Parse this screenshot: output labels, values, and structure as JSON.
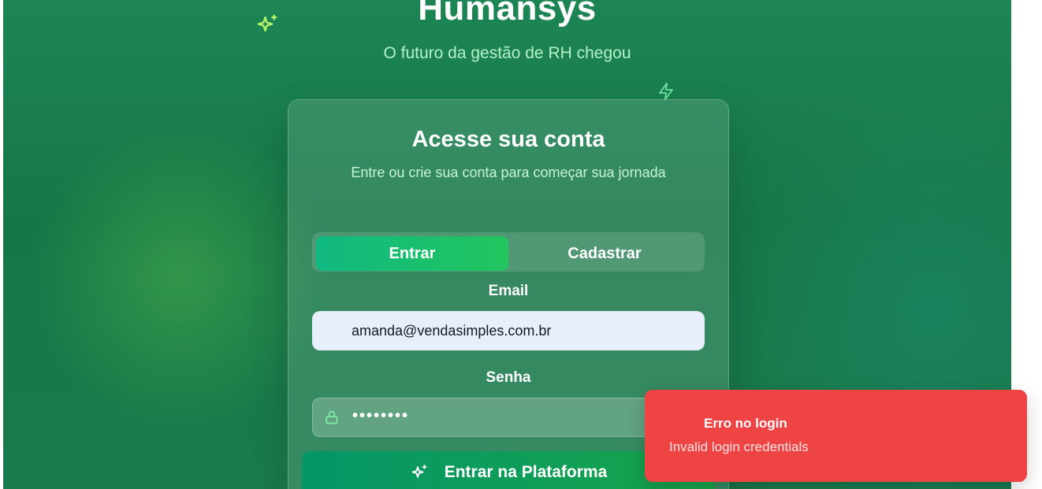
{
  "brand": {
    "title": "Humansys",
    "subtitle": "O futuro da gestão de RH chegou"
  },
  "card": {
    "title": "Acesse sua conta",
    "subtitle": "Entre ou crie sua conta para começar sua jornada"
  },
  "tabs": [
    {
      "label": "Entrar",
      "active": true
    },
    {
      "label": "Cadastrar",
      "active": false
    }
  ],
  "form": {
    "email_label": "Email",
    "email_value": "amanda@vendasimples.com.br",
    "password_label": "Senha",
    "password_value": "••••••••",
    "submit_label": "Entrar na Plataforma"
  },
  "toast": {
    "title": "Erro no login",
    "message": "Invalid login credentials"
  },
  "icons": {
    "decor_top": "sparkles-icon",
    "decor_right": "zap-icon",
    "password": "lock-icon",
    "submit": "sparkles-icon"
  },
  "colors": {
    "primary_gradient_start": "#10b981",
    "primary_gradient_end": "#22c55e",
    "error": "#ef4444",
    "background": "#167647"
  }
}
